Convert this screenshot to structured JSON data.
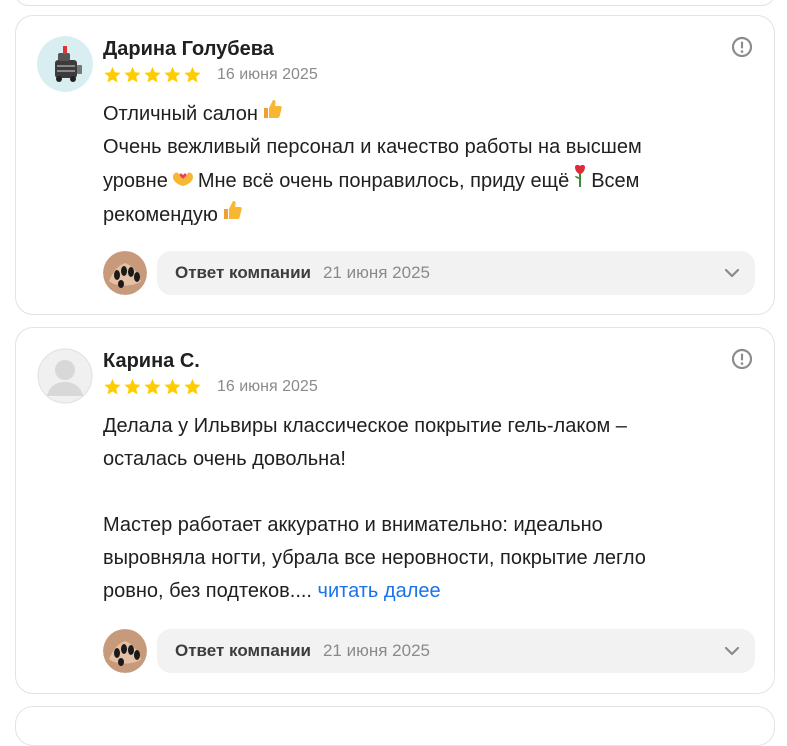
{
  "colors": {
    "star": "#ffcc00",
    "link": "#1a73e8",
    "reply_bg": "#f2f2f2",
    "muted": "#8a8a8a"
  },
  "reviews": [
    {
      "author": "Дарина Голубева",
      "rating": 5,
      "date": "16 июня 2025",
      "lines": [
        "Отличный салон",
        "Очень вежливый персонал и качество работы на высшем",
        "уровне",
        "Мне всё очень понравилось, приду ещё",
        "Всем",
        "рекомендую"
      ],
      "reply": {
        "label": "Ответ компании",
        "date": "21 июня 2025"
      }
    },
    {
      "author": "Карина С.",
      "rating": 5,
      "date": "16 июня 2025",
      "paragraph1": [
        "Делала у Ильвиры классическое покрытие гель-лаком –",
        "осталась очень довольна!"
      ],
      "paragraph2": [
        "Мастер работает аккуратно и внимательно: идеально",
        "выровняла ногти, убрала все неровности, покрытие легло",
        "ровно, без подтеков...."
      ],
      "read_more": "читать далее",
      "reply": {
        "label": "Ответ компании",
        "date": "21 июня 2025"
      }
    }
  ]
}
